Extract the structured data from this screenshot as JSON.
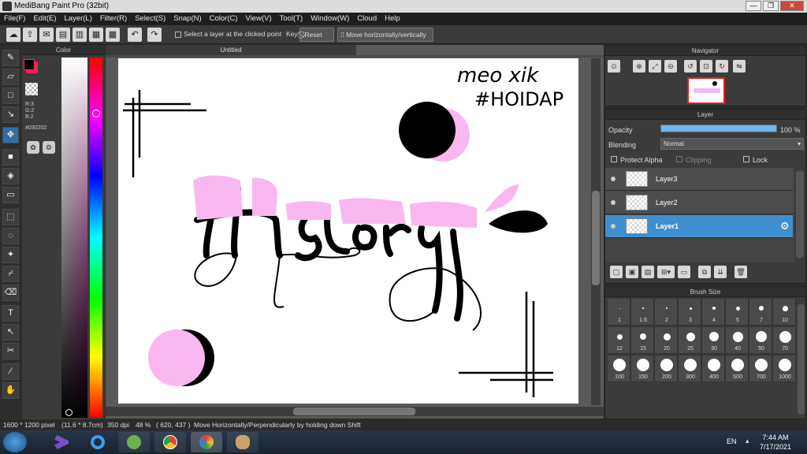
{
  "window": {
    "title": "MediBang Paint Pro (32bit)",
    "min": "—",
    "max": "❐",
    "close": "✕"
  },
  "menu": [
    "File(F)",
    "Edit(E)",
    "Layer(L)",
    "Filter(R)",
    "Select(S)",
    "Snap(N)",
    "Color(C)",
    "View(V)",
    "Tool(T)",
    "Window(W)",
    "Cloud",
    "Help"
  ],
  "toolbar": {
    "select_layer_label": "Select a layer at the clicked point",
    "key_label": "Key",
    "reset_label": "Reset",
    "move_label": "Move horizontally/vertically"
  },
  "color_panel": {
    "title": "Color",
    "r": "R:3",
    "g": "G:2",
    "b": "B:2",
    "hex": "#030202",
    "fg_color": "#030202",
    "bg_color": "#ff1a5a"
  },
  "canvas": {
    "tab_title": "Untitled",
    "texts": {
      "handle": "meo xik",
      "tag": "#HOIDAP",
      "word": "History"
    }
  },
  "navigator": {
    "title": "Navigator"
  },
  "layer_panel": {
    "title": "Layer",
    "opacity_label": "Opacity",
    "opacity_value": "100 %",
    "opacity_fraction": 1.0,
    "blending_label": "Blending",
    "blending_value": "Normal",
    "protect_alpha": "Protect Alpha",
    "clipping": "Clipping",
    "lock": "Lock",
    "layers": [
      {
        "name": "Layer3",
        "selected": false
      },
      {
        "name": "Layer2",
        "selected": false
      },
      {
        "name": "Layer1",
        "selected": true
      }
    ]
  },
  "brush_panel": {
    "title": "Brush Size",
    "sizes": [
      "1",
      "1.5",
      "2",
      "3",
      "4",
      "5",
      "7",
      "10",
      "12",
      "15",
      "20",
      "25",
      "30",
      "40",
      "50",
      "70",
      "100",
      "150",
      "200",
      "300",
      "400",
      "500",
      "700",
      "1000"
    ]
  },
  "status": {
    "dimensions": "1600 * 1200 pixel",
    "physical": "(11.6 * 8.7cm)",
    "dpi": "350 dpi",
    "zoom": "48 %",
    "coords": "( 620, 437 )",
    "hint": "Move Horizontally/Perpendicularly by holding down Shift"
  },
  "taskbar": {
    "lang": "EN",
    "time": "7:44 AM",
    "date": "7/17/2021"
  }
}
